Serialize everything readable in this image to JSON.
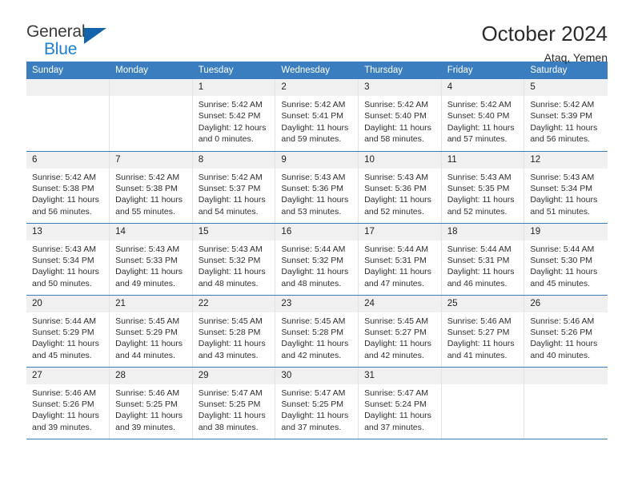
{
  "logo": {
    "word_one": "General",
    "word_two": "Blue",
    "triangle_color": "#1464ab",
    "blue_color": "#1c7fd4"
  },
  "header": {
    "title": "October 2024",
    "location": "Ataq, Yemen"
  },
  "theme": {
    "header_blue": "#3a7ec0",
    "daynum_gray": "#f0f0f0",
    "cell_border": "#e3e3e3"
  },
  "calendar": {
    "weekday_headers": [
      "Sunday",
      "Monday",
      "Tuesday",
      "Wednesday",
      "Thursday",
      "Friday",
      "Saturday"
    ],
    "weeks": [
      [
        {
          "day": ""
        },
        {
          "day": ""
        },
        {
          "day": "1",
          "sunrise": "Sunrise: 5:42 AM",
          "sunset": "Sunset: 5:42 PM",
          "daylight_1": "Daylight: 12 hours",
          "daylight_2": "and 0 minutes."
        },
        {
          "day": "2",
          "sunrise": "Sunrise: 5:42 AM",
          "sunset": "Sunset: 5:41 PM",
          "daylight_1": "Daylight: 11 hours",
          "daylight_2": "and 59 minutes."
        },
        {
          "day": "3",
          "sunrise": "Sunrise: 5:42 AM",
          "sunset": "Sunset: 5:40 PM",
          "daylight_1": "Daylight: 11 hours",
          "daylight_2": "and 58 minutes."
        },
        {
          "day": "4",
          "sunrise": "Sunrise: 5:42 AM",
          "sunset": "Sunset: 5:40 PM",
          "daylight_1": "Daylight: 11 hours",
          "daylight_2": "and 57 minutes."
        },
        {
          "day": "5",
          "sunrise": "Sunrise: 5:42 AM",
          "sunset": "Sunset: 5:39 PM",
          "daylight_1": "Daylight: 11 hours",
          "daylight_2": "and 56 minutes."
        }
      ],
      [
        {
          "day": "6",
          "sunrise": "Sunrise: 5:42 AM",
          "sunset": "Sunset: 5:38 PM",
          "daylight_1": "Daylight: 11 hours",
          "daylight_2": "and 56 minutes."
        },
        {
          "day": "7",
          "sunrise": "Sunrise: 5:42 AM",
          "sunset": "Sunset: 5:38 PM",
          "daylight_1": "Daylight: 11 hours",
          "daylight_2": "and 55 minutes."
        },
        {
          "day": "8",
          "sunrise": "Sunrise: 5:42 AM",
          "sunset": "Sunset: 5:37 PM",
          "daylight_1": "Daylight: 11 hours",
          "daylight_2": "and 54 minutes."
        },
        {
          "day": "9",
          "sunrise": "Sunrise: 5:43 AM",
          "sunset": "Sunset: 5:36 PM",
          "daylight_1": "Daylight: 11 hours",
          "daylight_2": "and 53 minutes."
        },
        {
          "day": "10",
          "sunrise": "Sunrise: 5:43 AM",
          "sunset": "Sunset: 5:36 PM",
          "daylight_1": "Daylight: 11 hours",
          "daylight_2": "and 52 minutes."
        },
        {
          "day": "11",
          "sunrise": "Sunrise: 5:43 AM",
          "sunset": "Sunset: 5:35 PM",
          "daylight_1": "Daylight: 11 hours",
          "daylight_2": "and 52 minutes."
        },
        {
          "day": "12",
          "sunrise": "Sunrise: 5:43 AM",
          "sunset": "Sunset: 5:34 PM",
          "daylight_1": "Daylight: 11 hours",
          "daylight_2": "and 51 minutes."
        }
      ],
      [
        {
          "day": "13",
          "sunrise": "Sunrise: 5:43 AM",
          "sunset": "Sunset: 5:34 PM",
          "daylight_1": "Daylight: 11 hours",
          "daylight_2": "and 50 minutes."
        },
        {
          "day": "14",
          "sunrise": "Sunrise: 5:43 AM",
          "sunset": "Sunset: 5:33 PM",
          "daylight_1": "Daylight: 11 hours",
          "daylight_2": "and 49 minutes."
        },
        {
          "day": "15",
          "sunrise": "Sunrise: 5:43 AM",
          "sunset": "Sunset: 5:32 PM",
          "daylight_1": "Daylight: 11 hours",
          "daylight_2": "and 48 minutes."
        },
        {
          "day": "16",
          "sunrise": "Sunrise: 5:44 AM",
          "sunset": "Sunset: 5:32 PM",
          "daylight_1": "Daylight: 11 hours",
          "daylight_2": "and 48 minutes."
        },
        {
          "day": "17",
          "sunrise": "Sunrise: 5:44 AM",
          "sunset": "Sunset: 5:31 PM",
          "daylight_1": "Daylight: 11 hours",
          "daylight_2": "and 47 minutes."
        },
        {
          "day": "18",
          "sunrise": "Sunrise: 5:44 AM",
          "sunset": "Sunset: 5:31 PM",
          "daylight_1": "Daylight: 11 hours",
          "daylight_2": "and 46 minutes."
        },
        {
          "day": "19",
          "sunrise": "Sunrise: 5:44 AM",
          "sunset": "Sunset: 5:30 PM",
          "daylight_1": "Daylight: 11 hours",
          "daylight_2": "and 45 minutes."
        }
      ],
      [
        {
          "day": "20",
          "sunrise": "Sunrise: 5:44 AM",
          "sunset": "Sunset: 5:29 PM",
          "daylight_1": "Daylight: 11 hours",
          "daylight_2": "and 45 minutes."
        },
        {
          "day": "21",
          "sunrise": "Sunrise: 5:45 AM",
          "sunset": "Sunset: 5:29 PM",
          "daylight_1": "Daylight: 11 hours",
          "daylight_2": "and 44 minutes."
        },
        {
          "day": "22",
          "sunrise": "Sunrise: 5:45 AM",
          "sunset": "Sunset: 5:28 PM",
          "daylight_1": "Daylight: 11 hours",
          "daylight_2": "and 43 minutes."
        },
        {
          "day": "23",
          "sunrise": "Sunrise: 5:45 AM",
          "sunset": "Sunset: 5:28 PM",
          "daylight_1": "Daylight: 11 hours",
          "daylight_2": "and 42 minutes."
        },
        {
          "day": "24",
          "sunrise": "Sunrise: 5:45 AM",
          "sunset": "Sunset: 5:27 PM",
          "daylight_1": "Daylight: 11 hours",
          "daylight_2": "and 42 minutes."
        },
        {
          "day": "25",
          "sunrise": "Sunrise: 5:46 AM",
          "sunset": "Sunset: 5:27 PM",
          "daylight_1": "Daylight: 11 hours",
          "daylight_2": "and 41 minutes."
        },
        {
          "day": "26",
          "sunrise": "Sunrise: 5:46 AM",
          "sunset": "Sunset: 5:26 PM",
          "daylight_1": "Daylight: 11 hours",
          "daylight_2": "and 40 minutes."
        }
      ],
      [
        {
          "day": "27",
          "sunrise": "Sunrise: 5:46 AM",
          "sunset": "Sunset: 5:26 PM",
          "daylight_1": "Daylight: 11 hours",
          "daylight_2": "and 39 minutes."
        },
        {
          "day": "28",
          "sunrise": "Sunrise: 5:46 AM",
          "sunset": "Sunset: 5:25 PM",
          "daylight_1": "Daylight: 11 hours",
          "daylight_2": "and 39 minutes."
        },
        {
          "day": "29",
          "sunrise": "Sunrise: 5:47 AM",
          "sunset": "Sunset: 5:25 PM",
          "daylight_1": "Daylight: 11 hours",
          "daylight_2": "and 38 minutes."
        },
        {
          "day": "30",
          "sunrise": "Sunrise: 5:47 AM",
          "sunset": "Sunset: 5:25 PM",
          "daylight_1": "Daylight: 11 hours",
          "daylight_2": "and 37 minutes."
        },
        {
          "day": "31",
          "sunrise": "Sunrise: 5:47 AM",
          "sunset": "Sunset: 5:24 PM",
          "daylight_1": "Daylight: 11 hours",
          "daylight_2": "and 37 minutes."
        },
        {
          "day": ""
        },
        {
          "day": ""
        }
      ]
    ]
  }
}
